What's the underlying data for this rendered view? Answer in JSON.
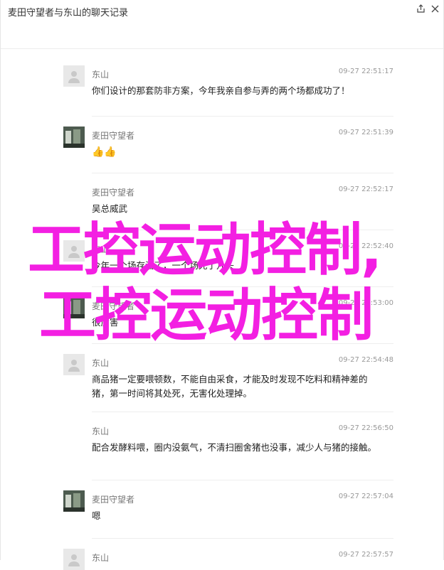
{
  "window": {
    "title": "麦田守望者与东山的聊天记录"
  },
  "messages": [
    {
      "name": "东山",
      "time": "09-27 22:51:17",
      "text": "你们设计的那套防非方案，今年我亲自参与弄的两个场都成功了！",
      "avatar": "default"
    },
    {
      "name": "麦田守望者",
      "time": "09-27 22:51:39",
      "text": "👍👍",
      "avatar": "photo"
    },
    {
      "name": "麦田守望者",
      "time": "09-27 22:52:17",
      "text": "吴总威武",
      "avatar": "none"
    },
    {
      "name": "东山",
      "time": "09-27 22:52:40",
      "text": "今年一个场存活了，一个场死了几头",
      "avatar": "default"
    },
    {
      "name": "麦田守望者",
      "time": "09-27 22:53:00",
      "text": "很厉害",
      "avatar": "photo"
    },
    {
      "name": "东山",
      "time": "09-27 22:54:48",
      "text": "商品猪一定要喂顿数，不能自由采食，才能及时发现不吃料和精神差的猪，第一时间将其处死，无害化处理掉。",
      "avatar": "default"
    },
    {
      "name": "东山",
      "time": "09-27 22:56:50",
      "text": "配合发酵料喂，圈内没氨气，不清扫圈舍猪也没事，减少人与猪的接触。",
      "avatar": "none"
    },
    {
      "name": "麦田守望者",
      "time": "09-27 22:57:04",
      "text": "嗯",
      "avatar": "photo"
    },
    {
      "name": "东山",
      "time": "09-27 22:57:57",
      "text": "",
      "avatar": "default"
    }
  ],
  "watermark": {
    "line1": "工控运动控制,",
    "line2": "工控运动控制",
    "color": "#f31fe2"
  },
  "icons": {
    "share": "share-icon",
    "close": "close-icon"
  }
}
